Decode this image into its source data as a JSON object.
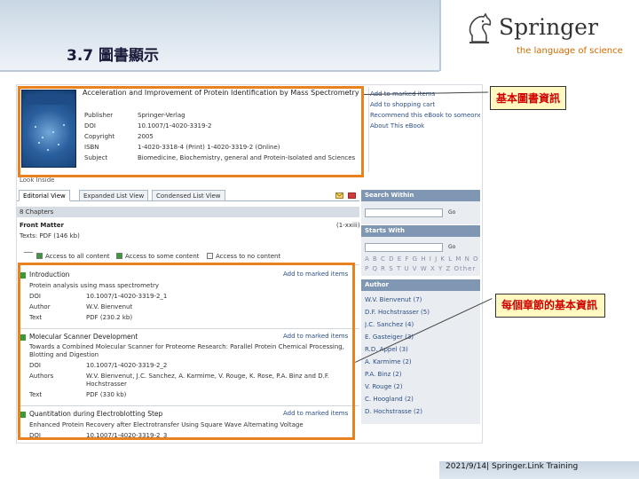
{
  "slide": {
    "title": "3.7 圖書顯示",
    "footer": "2021/9/14| Springer.Link Training"
  },
  "brand": {
    "name": "Springer",
    "tagline": "the language of science"
  },
  "book": {
    "title": "Acceleration and Improvement of Protein Identification by Mass Spectrometry",
    "meta": [
      {
        "label": "Publisher",
        "value": "Springer-Verlag"
      },
      {
        "label": "DOI",
        "value": "10.1007/1-4020-3319-2"
      },
      {
        "label": "Copyright",
        "value": "2005"
      },
      {
        "label": "ISBN",
        "value": "1-4020-3318-4 (Print) 1-4020-3319-2 (Online)"
      },
      {
        "label": "Subject",
        "value": "Biomedicine, Biochemistry, general and Protein-Isolated and Sciences"
      }
    ],
    "links": [
      "Add to marked items",
      "Add to shopping cart",
      "Recommend this eBook to someone",
      "About This eBook"
    ],
    "look_inside": "Look Inside"
  },
  "tabs": [
    "Editorial View",
    "Expanded List View",
    "Condensed List View"
  ],
  "subbar": "8 Chapters",
  "front_matter": {
    "title": "Front Matter",
    "more": "(1-xxiii)",
    "texts": "Texts: PDF (146 kb)"
  },
  "legend": [
    "Access to all content",
    "Access to some content",
    "Access to no content"
  ],
  "chapters": [
    {
      "title": "Introduction",
      "add": "Add to marked items",
      "sub": "Protein analysis using mass spectrometry",
      "rows": [
        {
          "label": "DOI",
          "value": "10.1007/1-4020-3319-2_1"
        },
        {
          "label": "Author",
          "value": "W.V. Bienvenut"
        },
        {
          "label": "Text",
          "value": "PDF (230.2 kb)"
        }
      ]
    },
    {
      "title": "Molecular Scanner Development",
      "add": "Add to marked items",
      "sub": "Towards a Combined Molecular Scanner for Proteome Research: Parallel Protein Chemical Processing, Blotting and Digestion",
      "rows": [
        {
          "label": "DOI",
          "value": "10.1007/1-4020-3319-2_2"
        },
        {
          "label": "Authors",
          "value": "W.V. Bienvenut, J.C. Sanchez, A. Karmime, V. Rouge, K. Rose, P.A. Binz and D.F. Hochstrasser"
        },
        {
          "label": "Text",
          "value": "PDF (330 kb)"
        }
      ]
    },
    {
      "title": "Quantitation during Electroblotting Step",
      "add": "Add to marked items",
      "sub": "Enhanced Protein Recovery after Electrotransfer Using Square Wave Alternating Voltage",
      "rows": [
        {
          "label": "DOI",
          "value": "10.1007/1-4020-3319-2_3"
        }
      ]
    }
  ],
  "sidebar": {
    "search_within": "Search Within",
    "starts_with": "Starts With",
    "go": "Go",
    "alpha_line1": "A B C D E F G H I J K L M N O",
    "alpha_line2": "P Q R S T U V W X Y Z Other",
    "author_head": "Author",
    "authors": [
      "W.V. Bienvenut (7)",
      "D.F. Hochstrasser (5)",
      "J.C. Sanchez (4)",
      "E. Gasteiger (3)",
      "R.D. Appel (3)",
      "A. Karmime (2)",
      "P.A. Binz (2)",
      "V. Rouge (2)",
      "C. Hoogland (2)",
      "D. Hochstrasse (2)"
    ]
  },
  "callouts": {
    "basic_info": "基本圖書資訊",
    "chapter_info": "每個章節的基本資訊"
  },
  "colors": {
    "highlight": "#e8821e",
    "callout_text": "#d10000",
    "callout_bg": "#fff8c0",
    "sidebar_head": "#7f97b2",
    "access_green": "#3a9a3a"
  }
}
